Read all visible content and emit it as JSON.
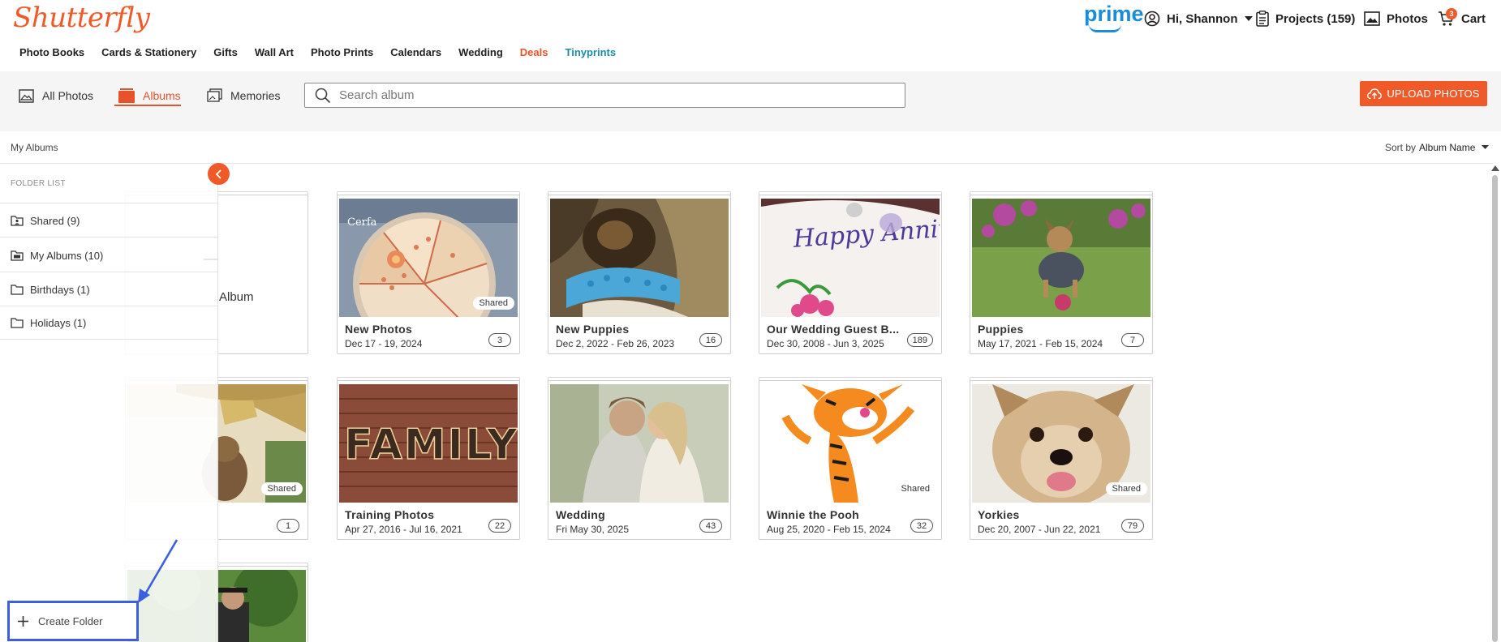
{
  "header": {
    "logo": "Shutterfly",
    "prime": "prime",
    "greeting": "Hi, Shannon",
    "projects": "Projects (159)",
    "photos": "Photos",
    "cart": "Cart",
    "cart_count": "3"
  },
  "nav": [
    "Photo Books",
    "Cards & Stationery",
    "Gifts",
    "Wall Art",
    "Photo Prints",
    "Calendars",
    "Wedding",
    "Deals",
    "Tinyprints"
  ],
  "colors": {
    "brand": "#f05a28",
    "tinyprints": "#1b8ca4",
    "highlight": "#3b5fe0"
  },
  "tabs": {
    "all_photos": "All Photos",
    "albums": "Albums",
    "memories": "Memories"
  },
  "search": {
    "placeholder": "Search album",
    "value": ""
  },
  "upload_button": "UPLOAD PHOTOS",
  "breadcrumb": "My Albums",
  "sort": {
    "label": "Sort by",
    "value": "Album Name"
  },
  "folder_panel": {
    "title": "FOLDER LIST",
    "folders": [
      {
        "label": "Shared (9)",
        "icon": "shared-folder-icon"
      },
      {
        "label": "My Albums (10)",
        "icon": "my-albums-folder-icon"
      },
      {
        "label": "Birthdays (1)",
        "icon": "folder-icon"
      },
      {
        "label": "Holidays (1)",
        "icon": "folder-icon"
      }
    ],
    "create_folder": "Create Folder"
  },
  "hidden_card": {
    "label": "Album"
  },
  "albums": [
    {
      "name": "New Photos",
      "dates": "Dec 17 - 19, 2024",
      "count": "3",
      "shared": "Shared"
    },
    {
      "name": "New Puppies",
      "dates": "Dec 2, 2022 - Feb 26, 2023",
      "count": "16",
      "shared": ""
    },
    {
      "name": "Our Wedding Guest B...",
      "dates": "Dec 30, 2008 - Jun 3, 2025",
      "count": "189",
      "shared": ""
    },
    {
      "name": "Puppies",
      "dates": "May 17, 2021 - Feb 15, 2024",
      "count": "7",
      "shared": ""
    },
    {
      "name": "",
      "dates": "",
      "count": "1",
      "shared": "Shared"
    },
    {
      "name": "Training Photos",
      "dates": "Apr 27, 2016 - Jul 16, 2021",
      "count": "22",
      "shared": ""
    },
    {
      "name": "Wedding",
      "dates": "Fri May 30, 2025",
      "count": "43",
      "shared": ""
    },
    {
      "name": "Winnie the Pooh",
      "dates": "Aug 25, 2020 - Feb 15, 2024",
      "count": "32",
      "shared": "Shared"
    },
    {
      "name": "Yorkies",
      "dates": "Dec 20, 2007 - Jun 22, 2021",
      "count": "79",
      "shared": "Shared"
    }
  ],
  "photo_overlays": {
    "cake_brand": "Cerfa",
    "wedding_cake": "Happy Anniversary",
    "family_sign": "FAMILY"
  }
}
